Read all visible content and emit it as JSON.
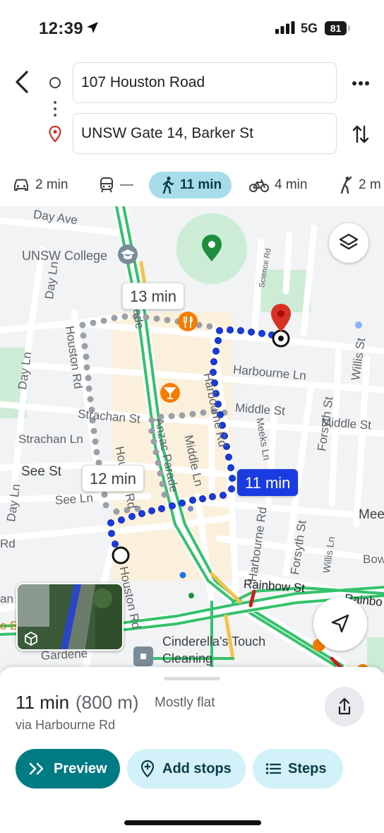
{
  "status_bar": {
    "time": "12:39",
    "network": "5G",
    "battery": "81",
    "icons": [
      "location-arrow-icon",
      "signal-bars-icon",
      "battery-icon"
    ]
  },
  "route": {
    "origin": "107 Houston Road",
    "destination": "UNSW Gate 14, Barker St",
    "icons": [
      "back-arrow-icon",
      "origin-circle-icon",
      "destination-pin-icon",
      "more-icon",
      "swap-icon"
    ]
  },
  "modes": [
    {
      "icon": "car-icon",
      "label": "2 min"
    },
    {
      "icon": "transit-icon",
      "label": "—"
    },
    {
      "icon": "walk-icon",
      "label": "11 min",
      "active": true
    },
    {
      "icon": "bike-icon",
      "label": "4 min"
    },
    {
      "icon": "rideshare-icon",
      "label": "2 m"
    }
  ],
  "map": {
    "streets": [
      "Day Ave",
      "Anzac Parade",
      "UNSW College",
      "Science Rd",
      "Harbourne Ln",
      "Houston Rd",
      "Day Ln",
      "Harbourne Rd",
      "Strachan St",
      "Middle St",
      "Forsyth St",
      "Willis St",
      "Strachan Ln",
      "Houston Rd",
      "Middle Ln",
      "Meeks Ln",
      "See St",
      "See Ln",
      "Anzac Parade",
      "Rd",
      "Mee",
      "Bow",
      "Harbourne Rd",
      "Forsyth St",
      "Willis Ln",
      "Rainbow St",
      "Rainbo",
      "Houston Rd",
      "Gardene",
      "Cinderella's Touch Cleaning",
      "Parade",
      "Day Ln",
      "Day Ln",
      "an",
      "o Ed"
    ],
    "bubbles": {
      "alt_top": "13 min",
      "alt_left": "12 min",
      "selected": "11 min"
    },
    "colors": {
      "route": "#1a3be0",
      "alt_route": "#9aa0a6",
      "main_road": "#34c26c",
      "pin": "#d93025"
    }
  },
  "sheet": {
    "duration": "11 min",
    "distance": "(800 m)",
    "terrain": "Mostly flat",
    "via": "via Harbourne Rd",
    "preview_label": "Preview",
    "add_stops_label": "Add stops",
    "steps_label": "Steps"
  }
}
